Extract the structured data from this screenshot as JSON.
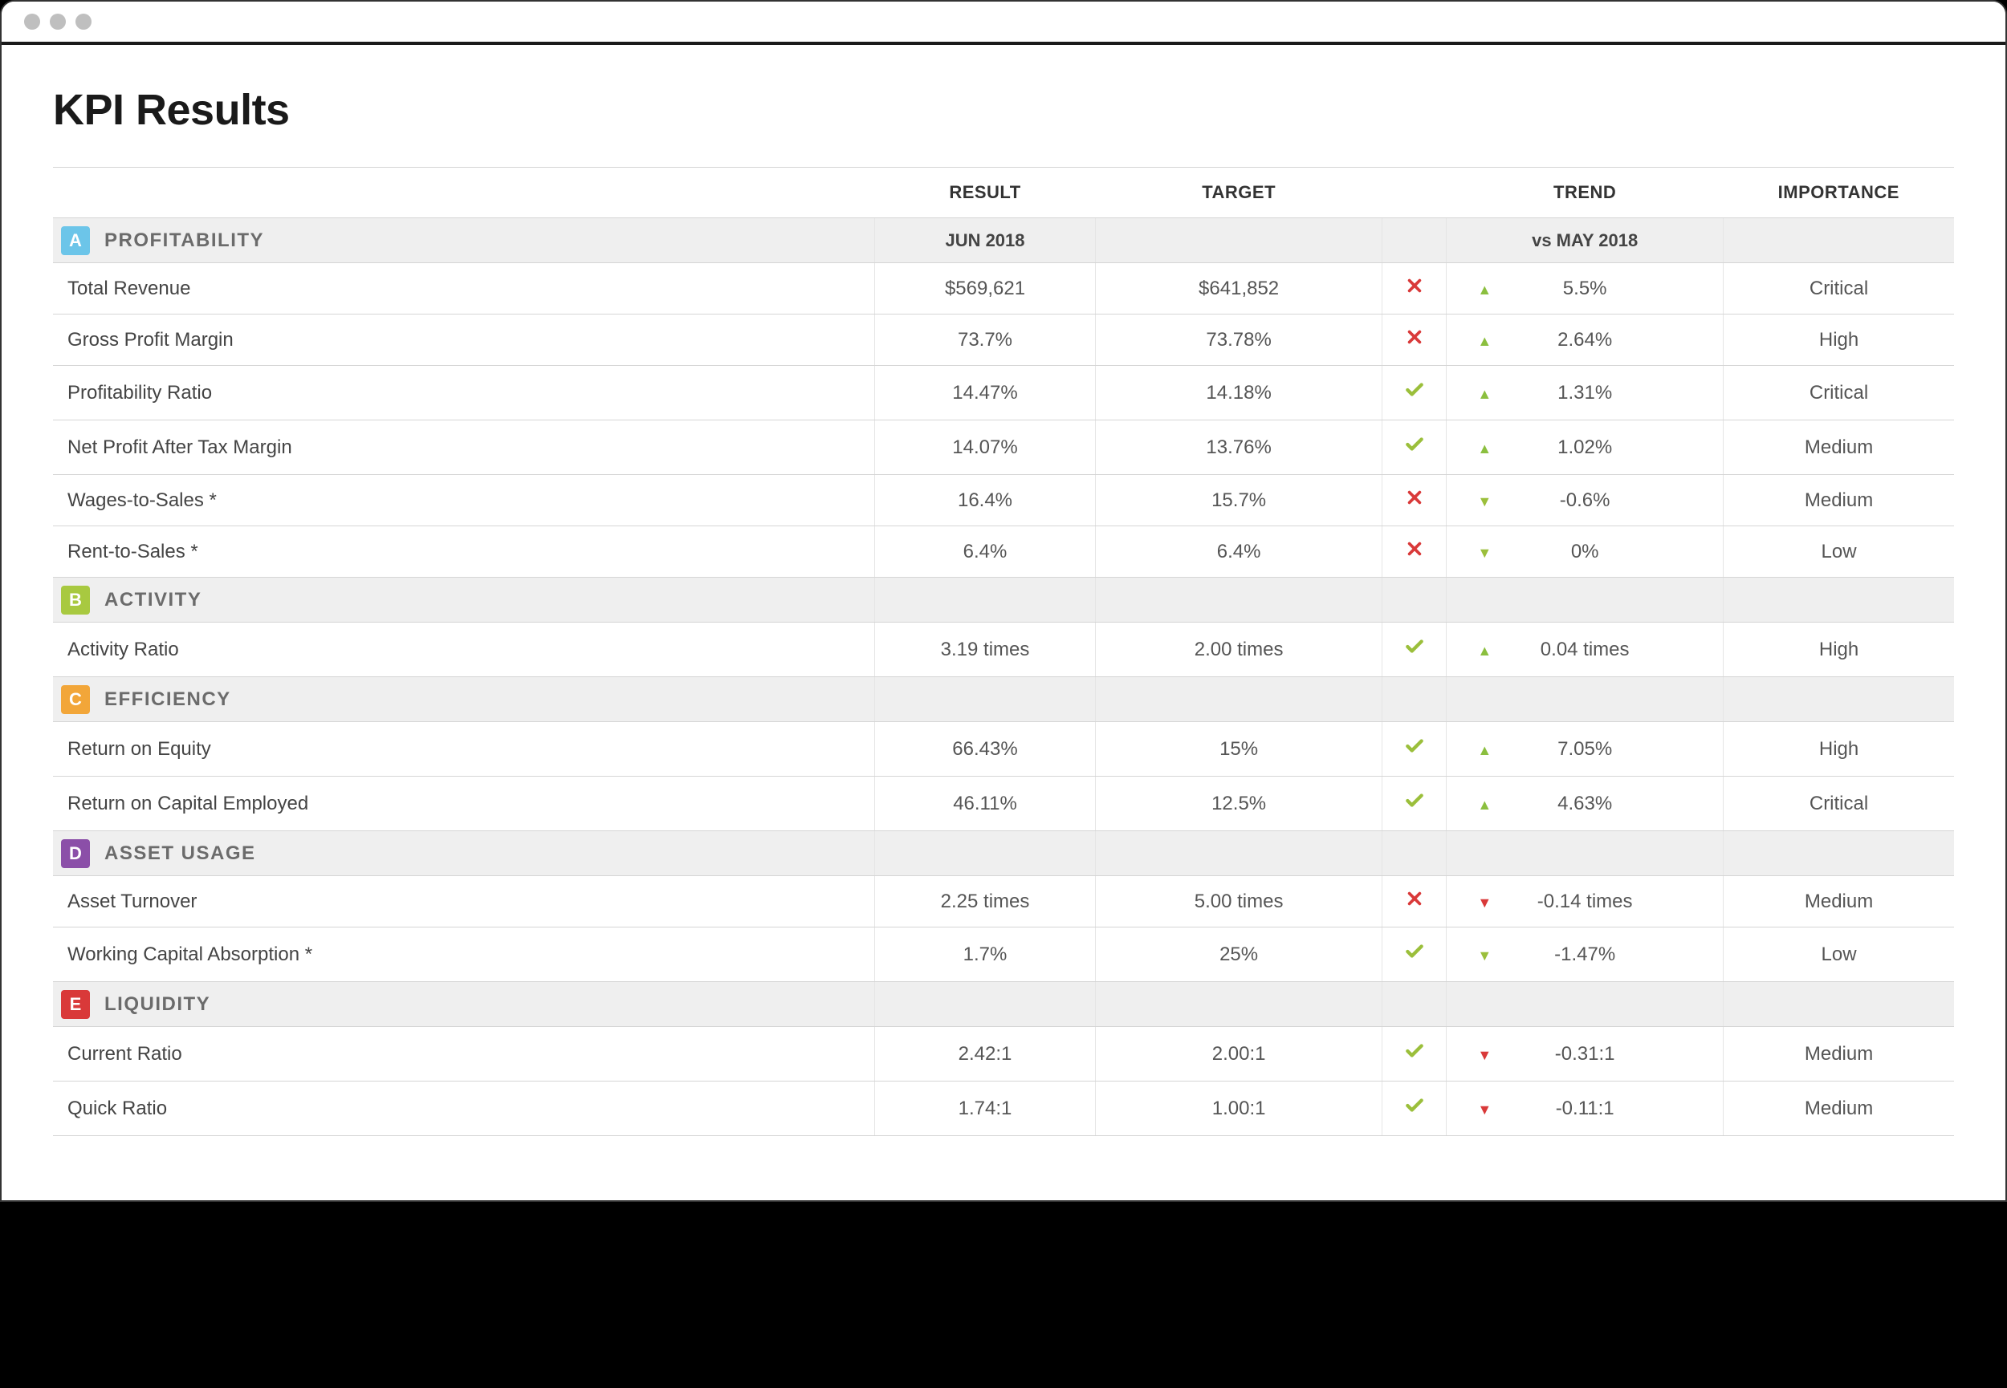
{
  "page_title": "KPI Results",
  "headers": {
    "name": "",
    "result": "RESULT",
    "target": "TARGET",
    "status": "",
    "trend": "TREND",
    "importance": "IMPORTANCE"
  },
  "sections": [
    {
      "letter": "A",
      "color": "#6cc5e9",
      "title": "PROFITABILITY",
      "result_sub": "JUN 2018",
      "trend_sub": "vs MAY 2018",
      "rows": [
        {
          "name": "Total Revenue",
          "result": "$569,621",
          "target": "$641,852",
          "status": "x",
          "trend_dir": "up-green",
          "trend_val": "5.5%",
          "importance": "Critical"
        },
        {
          "name": "Gross Profit Margin",
          "result": "73.7%",
          "target": "73.78%",
          "status": "x",
          "trend_dir": "up-green",
          "trend_val": "2.64%",
          "importance": "High"
        },
        {
          "name": "Profitability Ratio",
          "result": "14.47%",
          "target": "14.18%",
          "status": "check",
          "trend_dir": "up-green",
          "trend_val": "1.31%",
          "importance": "Critical"
        },
        {
          "name": "Net Profit After Tax Margin",
          "result": "14.07%",
          "target": "13.76%",
          "status": "check",
          "trend_dir": "up-green",
          "trend_val": "1.02%",
          "importance": "Medium"
        },
        {
          "name": "Wages-to-Sales *",
          "result": "16.4%",
          "target": "15.7%",
          "status": "x",
          "trend_dir": "down-green",
          "trend_val": "-0.6%",
          "importance": "Medium"
        },
        {
          "name": "Rent-to-Sales *",
          "result": "6.4%",
          "target": "6.4%",
          "status": "x",
          "trend_dir": "down-green",
          "trend_val": "0%",
          "importance": "Low"
        }
      ]
    },
    {
      "letter": "B",
      "color": "#a8c940",
      "title": "ACTIVITY",
      "result_sub": "",
      "trend_sub": "",
      "rows": [
        {
          "name": "Activity Ratio",
          "result": "3.19 times",
          "target": "2.00 times",
          "status": "check",
          "trend_dir": "up-green",
          "trend_val": "0.04 times",
          "importance": "High"
        }
      ]
    },
    {
      "letter": "C",
      "color": "#f2a639",
      "title": "EFFICIENCY",
      "result_sub": "",
      "trend_sub": "",
      "rows": [
        {
          "name": "Return on Equity",
          "result": "66.43%",
          "target": "15%",
          "status": "check",
          "trend_dir": "up-green",
          "trend_val": "7.05%",
          "importance": "High"
        },
        {
          "name": "Return on Capital Employed",
          "result": "46.11%",
          "target": "12.5%",
          "status": "check",
          "trend_dir": "up-green",
          "trend_val": "4.63%",
          "importance": "Critical"
        }
      ]
    },
    {
      "letter": "D",
      "color": "#8b4fa8",
      "title": "ASSET USAGE",
      "result_sub": "",
      "trend_sub": "",
      "rows": [
        {
          "name": "Asset Turnover",
          "result": "2.25 times",
          "target": "5.00 times",
          "status": "x",
          "trend_dir": "down-red",
          "trend_val": "-0.14 times",
          "importance": "Medium"
        },
        {
          "name": "Working Capital Absorption *",
          "result": "1.7%",
          "target": "25%",
          "status": "check",
          "trend_dir": "down-green",
          "trend_val": "-1.47%",
          "importance": "Low"
        }
      ]
    },
    {
      "letter": "E",
      "color": "#d93939",
      "title": "LIQUIDITY",
      "result_sub": "",
      "trend_sub": "",
      "rows": [
        {
          "name": "Current Ratio",
          "result": "2.42:1",
          "target": "2.00:1",
          "status": "check",
          "trend_dir": "down-red",
          "trend_val": "-0.31:1",
          "importance": "Medium"
        },
        {
          "name": "Quick Ratio",
          "result": "1.74:1",
          "target": "1.00:1",
          "status": "check",
          "trend_dir": "down-red",
          "trend_val": "-0.11:1",
          "importance": "Medium"
        }
      ]
    }
  ]
}
